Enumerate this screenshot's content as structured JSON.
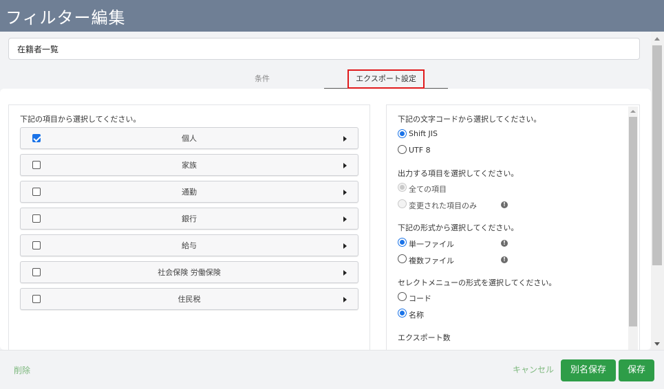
{
  "header": {
    "title": "フィルター編集"
  },
  "name_field": {
    "value": "在籍者一覧"
  },
  "tabs": [
    {
      "label": "条件",
      "active": false
    },
    {
      "label": "エクスポート設定",
      "active": true
    }
  ],
  "left": {
    "heading": "下記の項目から選択してください。",
    "items": [
      {
        "label": "個人",
        "checked": true
      },
      {
        "label": "家族",
        "checked": false
      },
      {
        "label": "通勤",
        "checked": false
      },
      {
        "label": "銀行",
        "checked": false
      },
      {
        "label": "給与",
        "checked": false
      },
      {
        "label": "社会保険 労働保険",
        "checked": false
      },
      {
        "label": "住民税",
        "checked": false
      }
    ]
  },
  "right": {
    "charset": {
      "heading": "下記の文字コードから選択してください。",
      "options": [
        "Shift JIS",
        "UTF 8"
      ]
    },
    "items": {
      "heading": "出力する項目を選択してください。",
      "options": [
        "全ての項目",
        "変更された項目のみ"
      ]
    },
    "format": {
      "heading": "下記の形式から選択してください。",
      "options": [
        "単一ファイル",
        "複数ファイル"
      ]
    },
    "select_menu": {
      "heading": "セレクトメニューの形式を選択してください。",
      "options": [
        "コード",
        "名称"
      ]
    },
    "export_count": {
      "heading": "エクスポート数"
    }
  },
  "footer": {
    "delete_label": "削除",
    "cancel_label": "キャンセル",
    "save_as_label": "別名保存",
    "save_label": "保存"
  },
  "colors": {
    "header_bg": "#6f7f95",
    "accent_green": "#2e9d48",
    "link_green": "#7db87d",
    "radio_blue": "#1a73e8",
    "highlight_red": "#e0191b"
  }
}
